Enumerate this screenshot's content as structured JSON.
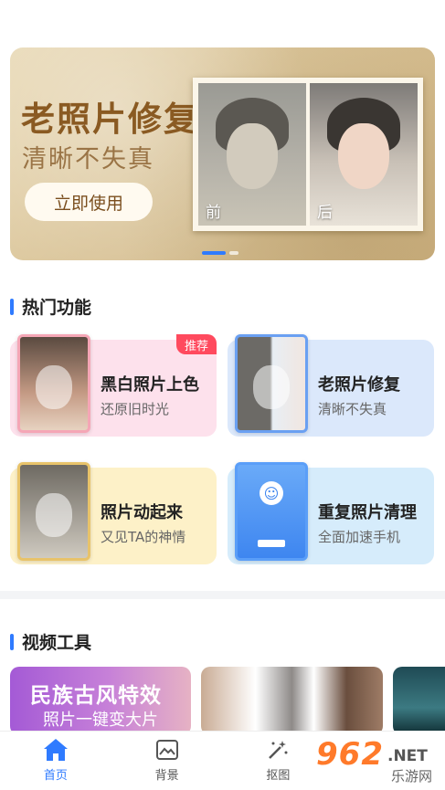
{
  "banner": {
    "title": "老照片修复",
    "subtitle": "清晰不失真",
    "button": "立即使用",
    "before_label": "前",
    "after_label": "后",
    "page_count": 2,
    "active_page": 1
  },
  "hot_features": {
    "title": "热门功能",
    "cards": [
      {
        "title": "黑白照片上色",
        "subtitle": "还原旧时光",
        "badge": "推荐"
      },
      {
        "title": "老照片修复",
        "subtitle": "清晰不失真"
      },
      {
        "title": "照片动起来",
        "subtitle": "又见TA的神情"
      },
      {
        "title": "重复照片清理",
        "subtitle": "全面加速手机"
      }
    ]
  },
  "video_tools": {
    "title": "视频工具",
    "tiles": [
      {
        "title": "民族古风特效",
        "subtitle": "照片一键变大片"
      }
    ]
  },
  "bottom_nav": {
    "items": [
      {
        "label": "首页",
        "icon": "home-icon",
        "active": true
      },
      {
        "label": "背景",
        "icon": "background-icon"
      },
      {
        "label": "抠图",
        "icon": "cutout-icon"
      }
    ]
  },
  "watermark": {
    "brand": "962",
    "net": ".NET",
    "site": "乐游网"
  },
  "colors": {
    "accent": "#2f7bff",
    "badge": "#ff4a5e",
    "banner_title": "#8a5a22"
  }
}
